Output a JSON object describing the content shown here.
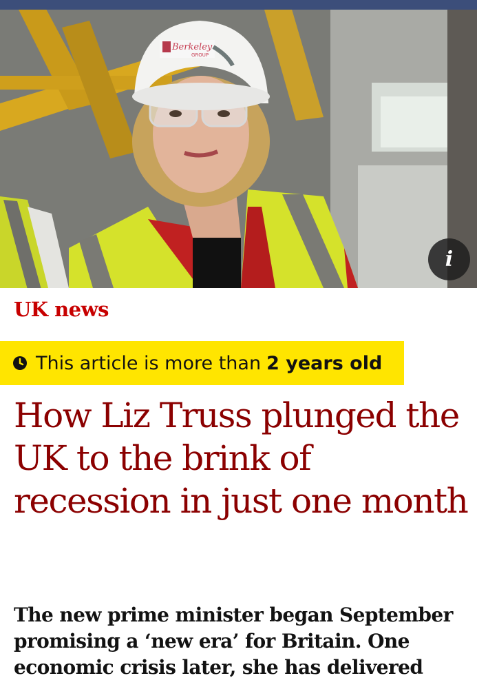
{
  "hero": {
    "helmet_logo": "Berkeley",
    "helmet_logo_sub": "GROUP",
    "info_icon": "i"
  },
  "article": {
    "section": "UK news",
    "age_warning": {
      "icon": "clock-icon",
      "prefix": "This article is more than",
      "emphasis": "2 years old"
    },
    "headline": "How Liz Truss plunged the UK to the brink of recession in just one month",
    "standfirst": "The new prime minister began September promising a ‘new era’ for Britain. One economic crisis later, she has delivered"
  },
  "colors": {
    "section": "#c70000",
    "headline": "#8b0000",
    "warning_bg": "#ffe500",
    "text": "#121212"
  }
}
